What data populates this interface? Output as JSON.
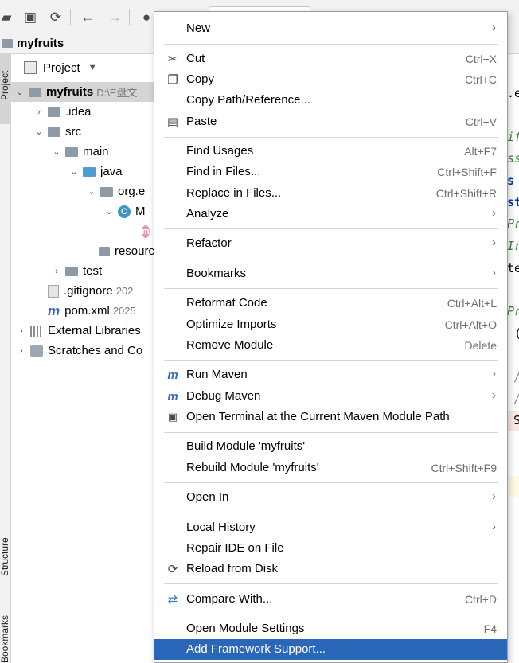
{
  "breadcrumb": {
    "project": "myfruits"
  },
  "left_strip": {
    "project_label": "Project",
    "structure_label": "Structure",
    "bookmarks_label": "Bookmarks"
  },
  "project_panel": {
    "header": "Project",
    "tree": [
      {
        "label": "myfruits",
        "meta": "D:\\E盘文",
        "bold": true
      },
      {
        "label": ".idea"
      },
      {
        "label": "src"
      },
      {
        "label": "main"
      },
      {
        "label": "java"
      },
      {
        "label": "org.e"
      },
      {
        "label": "M"
      },
      {
        "label": "resourc"
      },
      {
        "label": "test"
      },
      {
        "label": ".gitignore",
        "meta": "202"
      },
      {
        "label": "pom.xml",
        "meta": "2025"
      },
      {
        "label": "External Libraries"
      },
      {
        "label": "Scratches and Co"
      }
    ]
  },
  "editor_fragments": [
    ".e",
    "if",
    "ss",
    "s",
    "st",
    "Pr",
    "Ir",
    "te",
    "Pr",
    "(",
    "/",
    "/",
    "S"
  ],
  "menu": {
    "items": [
      {
        "label": "New",
        "shortcut": "",
        "submenu": true,
        "icon": ""
      },
      {
        "label": "Cut",
        "shortcut": "Ctrl+X",
        "submenu": false,
        "icon": "scissors-icon"
      },
      {
        "label": "Copy",
        "shortcut": "Ctrl+C",
        "submenu": false,
        "icon": "copy-icon"
      },
      {
        "label": "Copy Path/Reference...",
        "shortcut": "",
        "submenu": false,
        "icon": ""
      },
      {
        "label": "Paste",
        "shortcut": "Ctrl+V",
        "submenu": false,
        "icon": "clipboard-icon"
      },
      {
        "label": "Find Usages",
        "shortcut": "Alt+F7",
        "submenu": false,
        "icon": ""
      },
      {
        "label": "Find in Files...",
        "shortcut": "Ctrl+Shift+F",
        "submenu": false,
        "icon": ""
      },
      {
        "label": "Replace in Files...",
        "shortcut": "Ctrl+Shift+R",
        "submenu": false,
        "icon": ""
      },
      {
        "label": "Analyze",
        "shortcut": "",
        "submenu": true,
        "icon": ""
      },
      {
        "label": "Refactor",
        "shortcut": "",
        "submenu": true,
        "icon": ""
      },
      {
        "label": "Bookmarks",
        "shortcut": "",
        "submenu": true,
        "icon": ""
      },
      {
        "label": "Reformat Code",
        "shortcut": "Ctrl+Alt+L",
        "submenu": false,
        "icon": ""
      },
      {
        "label": "Optimize Imports",
        "shortcut": "Ctrl+Alt+O",
        "submenu": false,
        "icon": ""
      },
      {
        "label": "Remove Module",
        "shortcut": "Delete",
        "submenu": false,
        "icon": ""
      },
      {
        "label": "Run Maven",
        "shortcut": "",
        "submenu": true,
        "icon": "maven-run-icon"
      },
      {
        "label": "Debug Maven",
        "shortcut": "",
        "submenu": true,
        "icon": "maven-debug-icon"
      },
      {
        "label": "Open Terminal at the Current Maven Module Path",
        "shortcut": "",
        "submenu": false,
        "icon": "terminal-icon"
      },
      {
        "label": "Build Module 'myfruits'",
        "shortcut": "",
        "submenu": false,
        "icon": ""
      },
      {
        "label": "Rebuild Module 'myfruits'",
        "shortcut": "Ctrl+Shift+F9",
        "submenu": false,
        "icon": ""
      },
      {
        "label": "Open In",
        "shortcut": "",
        "submenu": true,
        "icon": ""
      },
      {
        "label": "Local History",
        "shortcut": "",
        "submenu": true,
        "icon": ""
      },
      {
        "label": "Repair IDE on File",
        "shortcut": "",
        "submenu": false,
        "icon": ""
      },
      {
        "label": "Reload from Disk",
        "shortcut": "",
        "submenu": false,
        "icon": "reload-icon"
      },
      {
        "label": "Compare With...",
        "shortcut": "Ctrl+D",
        "submenu": false,
        "icon": "compare-icon"
      },
      {
        "label": "Open Module Settings",
        "shortcut": "F4",
        "submenu": false,
        "icon": ""
      },
      {
        "label": "Add Framework Support...",
        "shortcut": "",
        "submenu": false,
        "icon": "",
        "active": true
      }
    ]
  }
}
